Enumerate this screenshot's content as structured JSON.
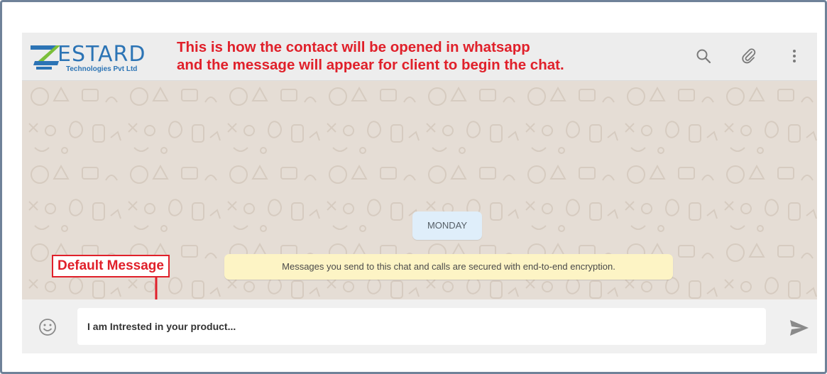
{
  "header": {
    "logo_word": "ESTARD",
    "logo_subtitle": "Technologies Pvt Ltd",
    "annotation_line1": "This is how the contact will be opened in whatsapp",
    "annotation_line2": "and the message will appear for client to begin the chat.",
    "icons": [
      "search-icon",
      "attach-icon",
      "menu-icon"
    ]
  },
  "chat": {
    "day_label": "MONDAY",
    "encryption_notice": "Messages you send to this chat and calls are secured with end-to-end encryption."
  },
  "annotation": {
    "default_message_label": "Default Message"
  },
  "composer": {
    "message_text": "I am Intrested in your product...",
    "icons": [
      "emoji-icon",
      "send-icon"
    ]
  },
  "colors": {
    "annotation_red": "#e0202a",
    "logo_blue": "#2c74b5",
    "logo_green": "#7bbf3a",
    "chat_background": "#e5ddd5",
    "day_chip": "#dfeefa",
    "encryption_bg": "#fdf4c5"
  }
}
